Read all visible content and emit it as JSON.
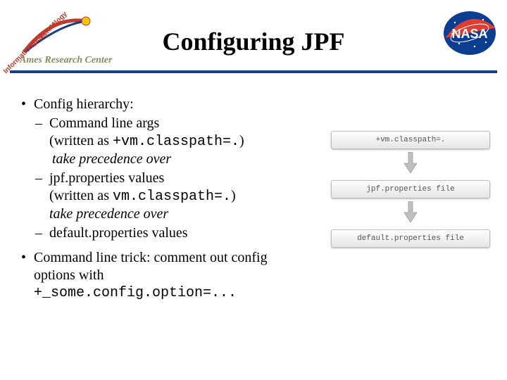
{
  "header": {
    "title": "Configuring JPF",
    "ames_label": "Ames Research Center",
    "ames_tag1": "Information Sciences",
    "ames_tag2": "& Technology",
    "nasa_label": "NASA"
  },
  "content": {
    "b1_hierarchy": "Config hierarchy:",
    "hier_cmd_line1": "Command line args",
    "hier_cmd_line2_a": "(written as ",
    "hier_cmd_line2_code": "+vm.classpath=.",
    "hier_cmd_line2_b": ")",
    "hier_cmd_line3": "take precedence over",
    "hier_jpf_line1": "jpf.properties values",
    "hier_jpf_line2_a": "(written as ",
    "hier_jpf_line2_code": "vm.classpath=.",
    "hier_jpf_line2_b": ")",
    "hier_jpf_line3": "take precedence over",
    "hier_default_line1": "default.properties values",
    "b1_trick_a": "Command line trick: comment out config options with",
    "trick_code": "+_some.config.option=..."
  },
  "stack": {
    "tab1": "+vm.classpath=.",
    "tab2": "jpf.properties file",
    "tab3": "default.properties file"
  },
  "colors": {
    "rule": "#153d8a",
    "ames_red": "#c0392b",
    "nasa_bg": "#0b3d91",
    "nasa_red": "#e03c31"
  }
}
